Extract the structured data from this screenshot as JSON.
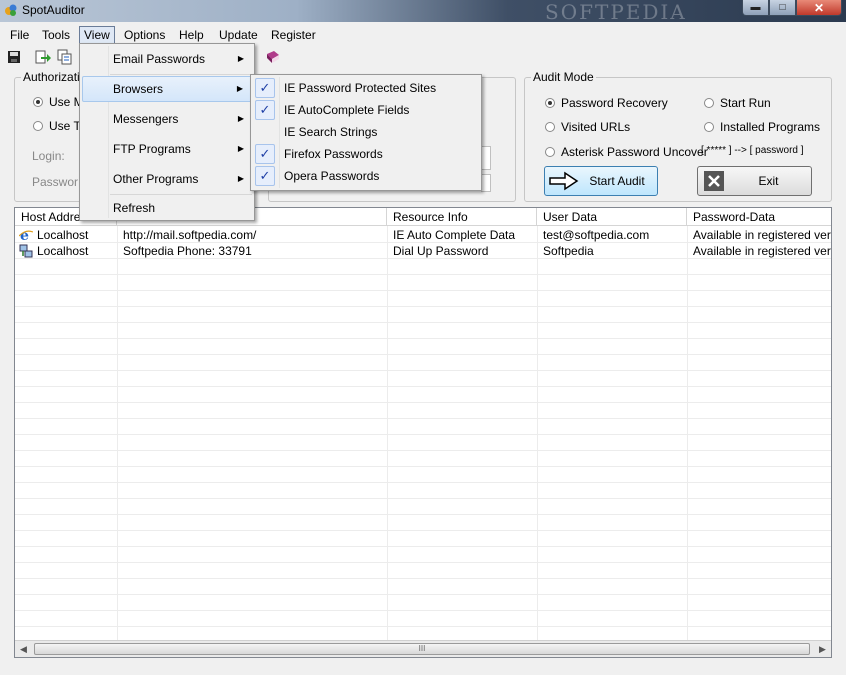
{
  "window": {
    "title": "SpotAuditor",
    "watermark": "SOFTPEDIA"
  },
  "menubar": [
    "File",
    "Tools",
    "View",
    "Options",
    "Help",
    "Update",
    "Register"
  ],
  "auth_group": {
    "title": "Authorizatio",
    "use_m": "Use M",
    "use_t": "Use T",
    "login_label": "Login:",
    "password_label": "Passwor"
  },
  "audit_mode": {
    "title": "Audit Mode",
    "options": [
      "Password Recovery",
      "Start Run",
      "Visited URLs",
      "Installed Programs",
      "Asterisk Password Uncover"
    ],
    "asterisk_hint": "[ ***** ] --> [ password ]",
    "start_label": "Start Audit",
    "exit_label": "Exit"
  },
  "table": {
    "columns": [
      "Host Address",
      "",
      "Resource Info",
      "User Data",
      "Password-Data"
    ],
    "rows": [
      {
        "host": "Localhost",
        "resource": "http://mail.softpedia.com/",
        "info": "IE Auto Complete Data",
        "user": "test@softpedia.com",
        "password": "Available in registered version"
      },
      {
        "host": "Localhost",
        "resource": "Softpedia Phone: 33791",
        "info": "Dial Up Password",
        "user": "Softpedia",
        "password": "Available in registered version"
      }
    ]
  },
  "view_menu": {
    "items": [
      "Email Passwords",
      "Browsers",
      "Messengers",
      "FTP Programs",
      "Other Programs",
      "Refresh"
    ]
  },
  "browsers_submenu": {
    "items": [
      {
        "label": "IE Password Protected Sites",
        "checked": true
      },
      {
        "label": "IE AutoComplete Fields",
        "checked": true
      },
      {
        "label": "IE Search Strings",
        "checked": false
      },
      {
        "label": "Firefox Passwords",
        "checked": true
      },
      {
        "label": "Opera Passwords",
        "checked": true
      }
    ]
  },
  "scrollbar": {
    "thumb_grip": "III"
  },
  "colors": {
    "accent": "#3c7fb1",
    "check": "#1f3fa6",
    "title_bar_dark": "#2b3a4f"
  }
}
